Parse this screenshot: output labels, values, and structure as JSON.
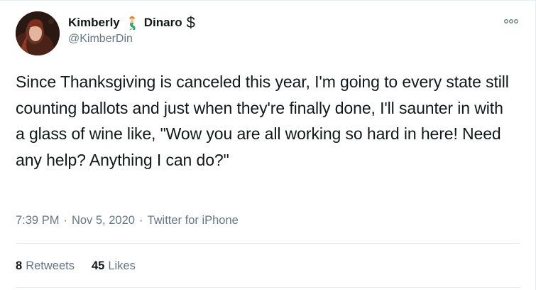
{
  "user": {
    "name_first": "Kimberly",
    "name_emoji": "mermaid-emoji",
    "name_last": "Dinaro",
    "name_suffix": "$",
    "handle": "@KimberDin",
    "avatar": "profile-photo"
  },
  "tweet": {
    "text": "Since Thanksgiving is canceled this year, I'm going to every state still counting ballots and just when they're finally done, I'll saunter in with a glass of wine like, \"Wow you are all working so hard in here! Need any help? Anything I can do?\"",
    "time": "7:39 PM",
    "separator": "·",
    "date": "Nov 5, 2020",
    "source": "Twitter for iPhone"
  },
  "stats": {
    "retweets_count": "8",
    "retweets_label": "Retweets",
    "likes_count": "45",
    "likes_label": "Likes"
  },
  "icons": {
    "more": "more-options-icon"
  },
  "colors": {
    "text": "#14171a",
    "secondary": "#657786",
    "divider": "#e6ecf0"
  }
}
